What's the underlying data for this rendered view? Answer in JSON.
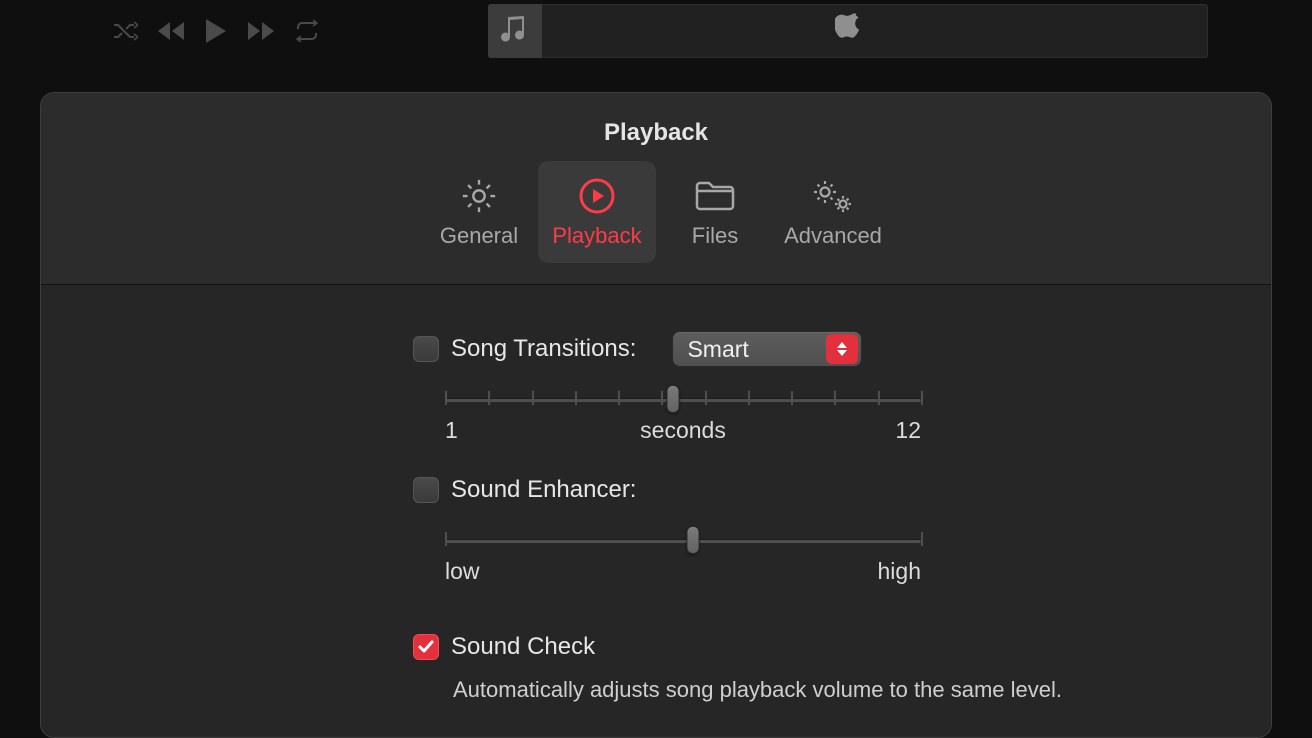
{
  "topbar": {
    "lcd_icon": "music-note",
    "center_icon": "apple"
  },
  "sheet": {
    "title": "Playback",
    "tabs": [
      {
        "label": "General",
        "icon": "gear"
      },
      {
        "label": "Playback",
        "icon": "play-circle",
        "active": true
      },
      {
        "label": "Files",
        "icon": "folder"
      },
      {
        "label": "Advanced",
        "icon": "gears"
      }
    ]
  },
  "transitions": {
    "label": "Song Transitions:",
    "checked": false,
    "select_value": "Smart",
    "slider": {
      "min_label": "1",
      "center_label": "seconds",
      "max_label": "12",
      "position": 0.48
    }
  },
  "enhancer": {
    "label": "Sound Enhancer:",
    "checked": false,
    "slider": {
      "min_label": "low",
      "max_label": "high",
      "position": 0.52
    }
  },
  "sound_check": {
    "label": "Sound Check",
    "checked": true,
    "description": "Automatically adjusts song playback volume to the same level."
  },
  "colors": {
    "accent": "#e2313d"
  }
}
